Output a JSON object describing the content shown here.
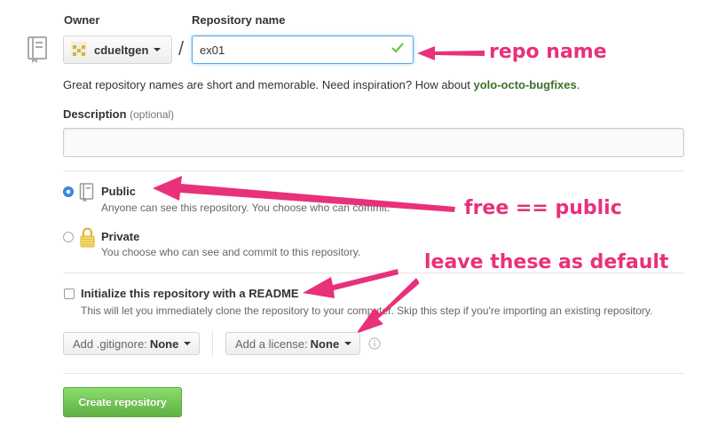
{
  "owner_label": "Owner",
  "repo_label": "Repository name",
  "owner": {
    "name": "cdueltgen"
  },
  "slash": "/",
  "repo_name_value": "ex01",
  "hint": {
    "text": "Great repository names are short and memorable. Need inspiration? How about ",
    "suggestion": "yolo-octo-bugfixes",
    "end": "."
  },
  "description": {
    "label": "Description",
    "optional": "(optional)",
    "value": ""
  },
  "visibility": {
    "public": {
      "label": "Public",
      "desc": "Anyone can see this repository. You choose who can commit.",
      "selected": true
    },
    "private": {
      "label": "Private",
      "desc": "You choose who can see and commit to this repository.",
      "selected": false
    }
  },
  "readme": {
    "label": "Initialize this repository with a README",
    "desc": "This will let you immediately clone the repository to your computer. Skip this step if you're importing an existing repository.",
    "checked": false
  },
  "gitignore": {
    "prefix": "Add .gitignore:",
    "value": "None"
  },
  "license": {
    "prefix": "Add a license:",
    "value": "None"
  },
  "create_button": "Create repository",
  "annotations": {
    "repo_name": "repo name",
    "free_public": "free == public",
    "defaults": "leave these as default"
  },
  "colors": {
    "annotation": "#e8317a",
    "create_button": "#6cc644",
    "suggestion": "#3f6e2a",
    "check": "#6cc644"
  }
}
